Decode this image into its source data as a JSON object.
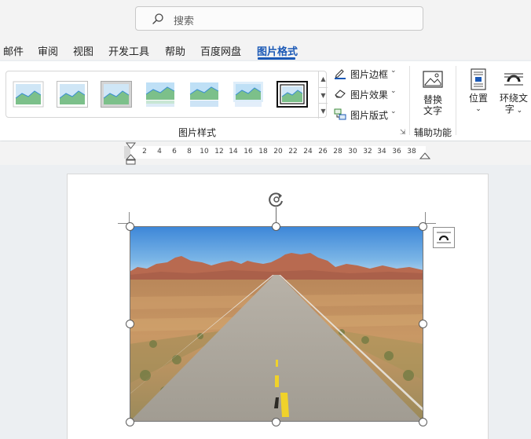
{
  "search": {
    "label": "搜索"
  },
  "tabs": [
    {
      "label": "邮件"
    },
    {
      "label": "审阅"
    },
    {
      "label": "视图"
    },
    {
      "label": "开发工具"
    },
    {
      "label": "帮助"
    },
    {
      "label": "百度网盘"
    },
    {
      "label": "图片格式",
      "active": true
    }
  ],
  "ribbon": {
    "picture_styles_group": "图片样式",
    "picture_border": "图片边框",
    "picture_effects": "图片效果",
    "picture_layout": "图片版式",
    "alt_text_line1": "替换",
    "alt_text_line2": "文字",
    "accessibility_group": "辅助功能",
    "position": "位置",
    "wrap_text_line1": "环绕文",
    "wrap_text_line2": "字"
  },
  "ruler": {
    "numbers": [
      "2",
      "4",
      "6",
      "8",
      "10",
      "12",
      "14",
      "16",
      "18",
      "20",
      "22",
      "24",
      "26",
      "28",
      "30",
      "32",
      "34",
      "36",
      "38"
    ]
  },
  "colors": {
    "accent": "#1b59b6",
    "sky": "#4a8fd8",
    "road": "#a8a49b"
  }
}
